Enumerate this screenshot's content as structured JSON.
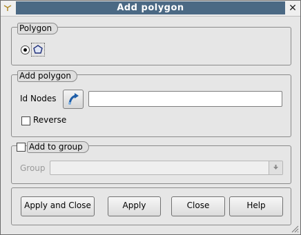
{
  "window": {
    "title": "Add polygon"
  },
  "polygon_group": {
    "title": "Polygon"
  },
  "add_polygon_group": {
    "title": "Add polygon",
    "id_nodes_label": "Id Nodes",
    "id_nodes_value": "",
    "reverse_label": "Reverse"
  },
  "add_to_group": {
    "title": "Add to group",
    "group_label": "Group",
    "group_value": ""
  },
  "buttons": {
    "apply_close": "Apply and Close",
    "apply": "Apply",
    "close": "Close",
    "help": "Help"
  },
  "colors": {
    "title_bar": "#4b6984",
    "window_bg": "#e6e6e6"
  }
}
